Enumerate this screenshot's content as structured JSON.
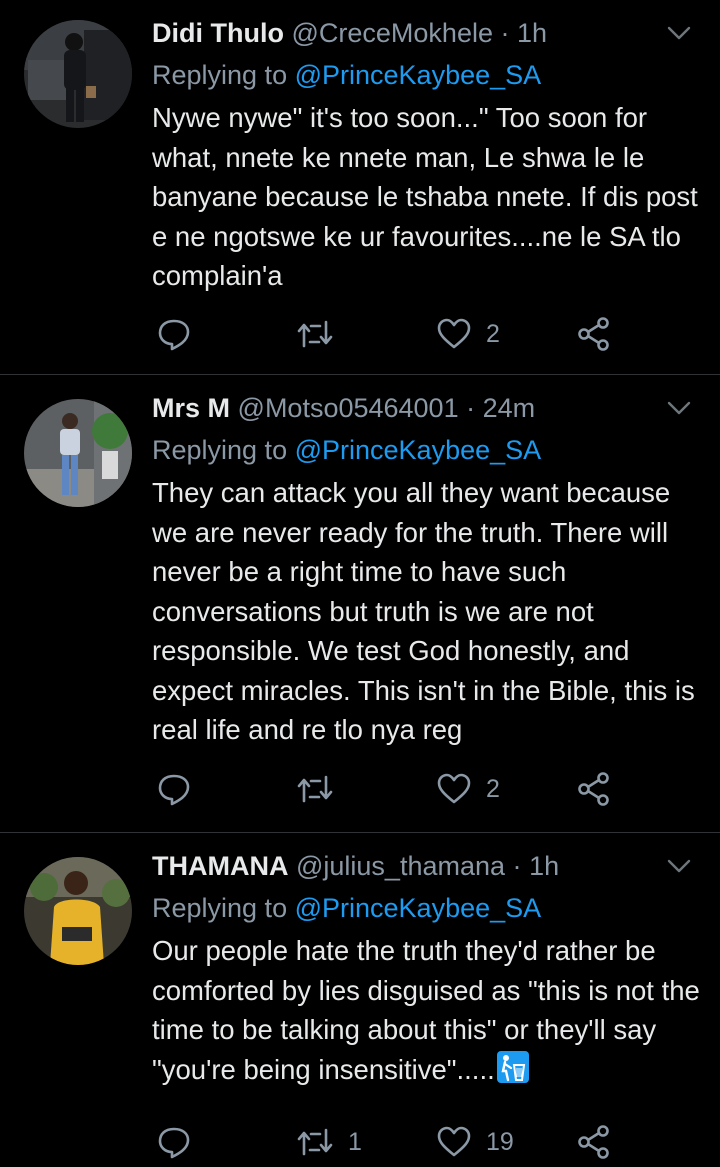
{
  "tweets": [
    {
      "name": "Didi Thulo",
      "handle": "@CreceMokhele",
      "separator": "·",
      "time": "1h",
      "replying_prefix": "Replying to",
      "replying_mention": "@PrinceKaybee_SA",
      "text": "Nywe nywe\" it's too soon...\" Too soon for what,  nnete ke nnete man, Le shwa le le banyane because le tshaba nnete. If dis post e ne ngotswe ke ur favourites....ne le SA tlo complain'a",
      "replies": "",
      "retweets": "",
      "likes": "2"
    },
    {
      "name": "Mrs M",
      "handle": "@Motso05464001",
      "separator": "·",
      "time": "24m",
      "replying_prefix": "Replying to",
      "replying_mention": "@PrinceKaybee_SA",
      "text": "They can attack you all they want because we are never ready for the truth. There will never be a right time to have such conversations but truth is we are not responsible. We test God honestly, and expect miracles. This isn't in the Bible, this is real life and re tlo nya reg",
      "replies": "",
      "retweets": "",
      "likes": "2"
    },
    {
      "name": "THAMANA",
      "handle": "@julius_thamana",
      "separator": "·",
      "time": "1h",
      "replying_prefix": "Replying to",
      "replying_mention": "@PrinceKaybee_SA",
      "text": "Our people hate the truth they'd rather be comforted by lies disguised as \"this is not the time to be talking about this\" or they'll say \"you're being insensitive\".....",
      "text_emoji": "wastebasket-emoji",
      "replies": "",
      "retweets": "1",
      "likes": "19"
    }
  ],
  "icons": {
    "reply": "reply-icon",
    "retweet": "retweet-icon",
    "like": "heart-icon",
    "share": "share-icon",
    "more": "chevron-down-icon"
  },
  "colors": {
    "background": "#000000",
    "text": "#e7e9ea",
    "secondary": "#8b98a5",
    "accent": "#1d9bf0",
    "divider": "#2f3336"
  }
}
